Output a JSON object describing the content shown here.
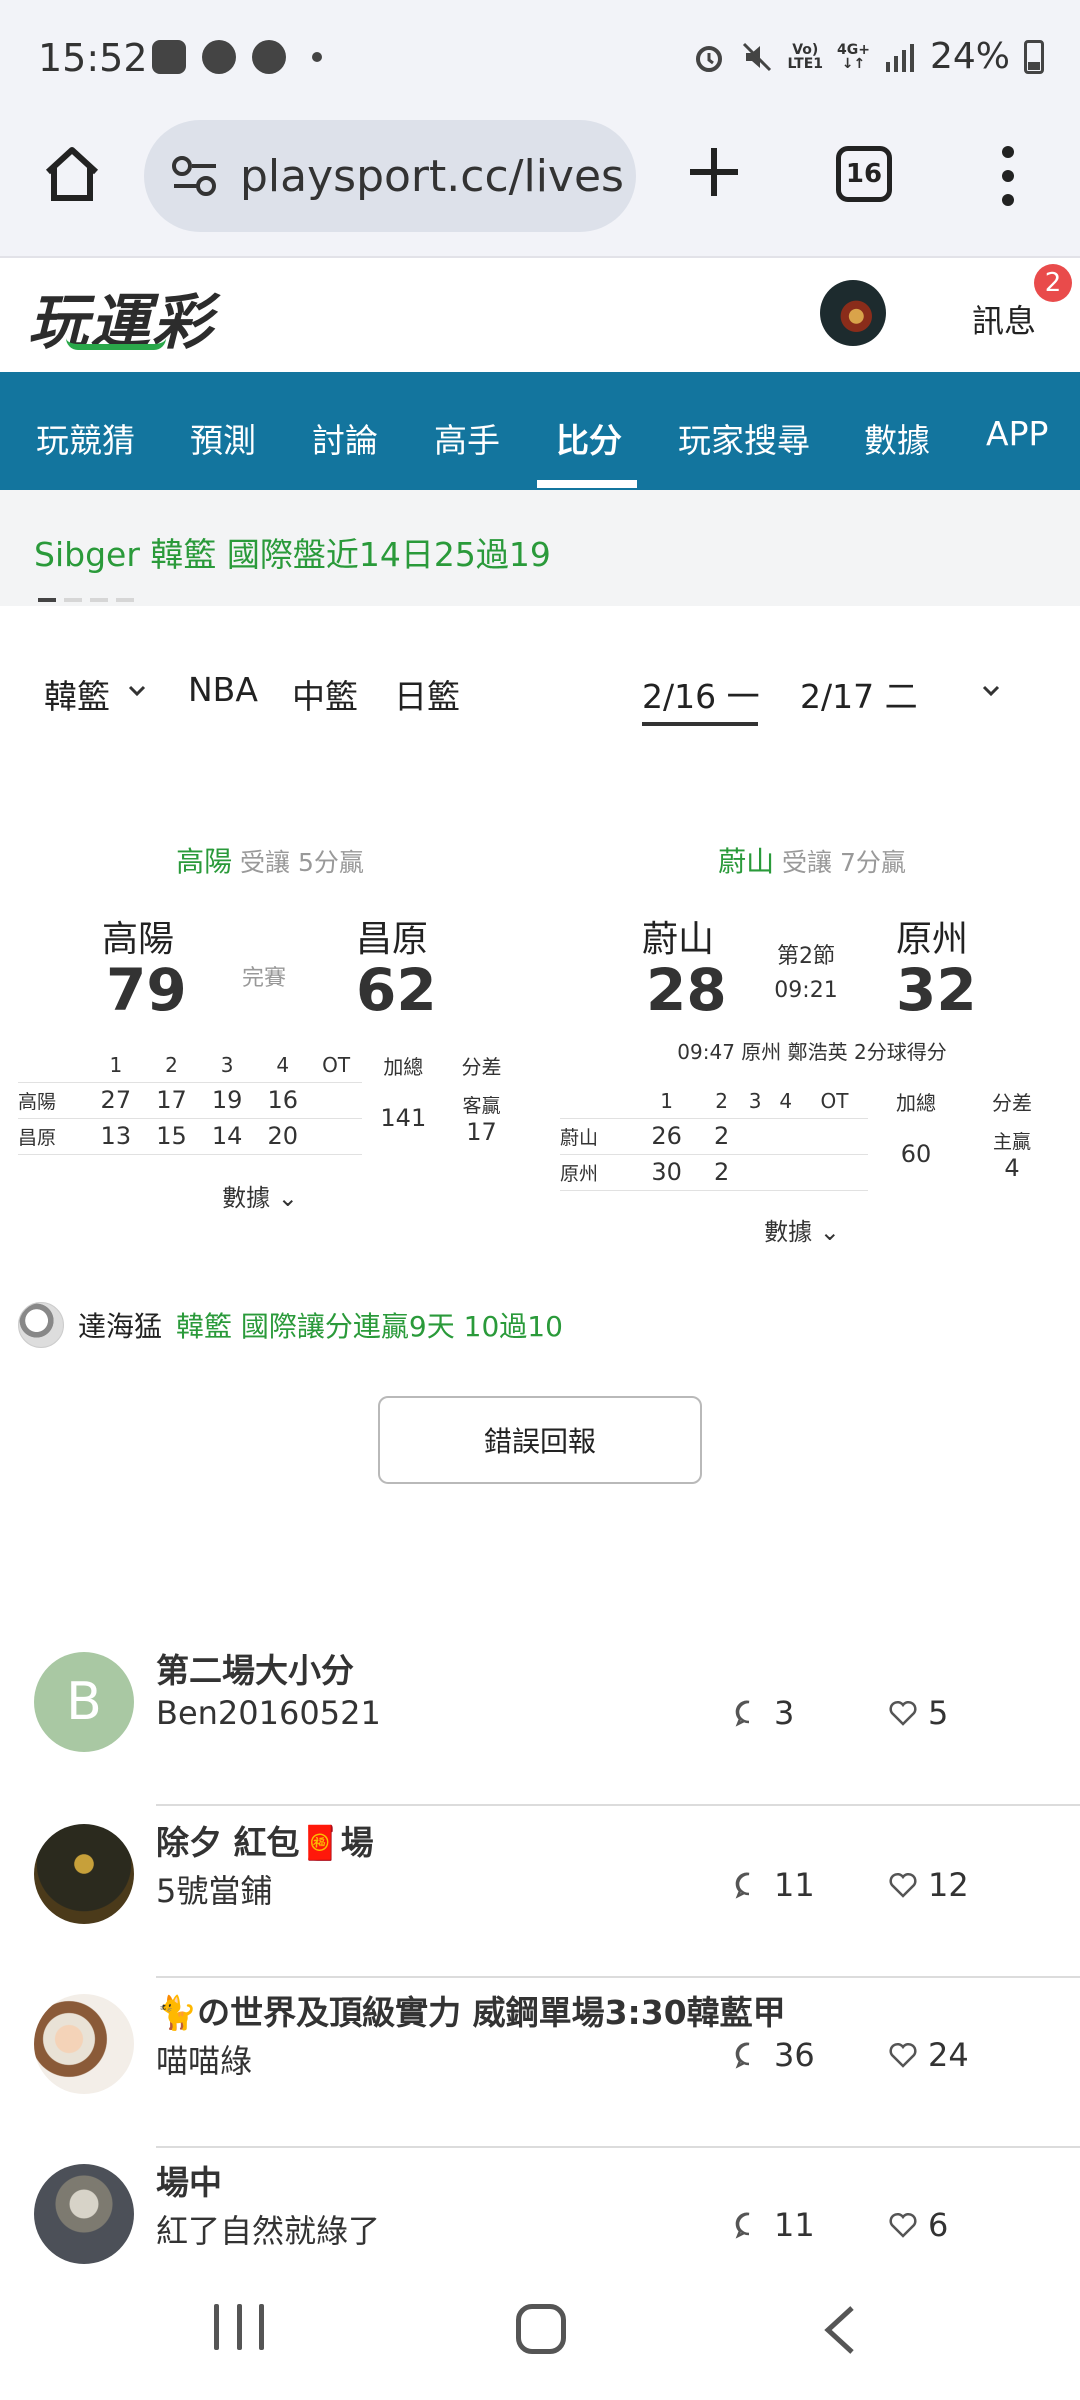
{
  "status_bar": {
    "time": "15:52",
    "network_top": "Vo)",
    "network_bottom": "LTE1",
    "data_top": "4G+",
    "data_bottom": "↓↑",
    "battery": "24%"
  },
  "browser": {
    "url": "playsport.cc/lives",
    "tab_count": "16"
  },
  "site": {
    "logo": "玩運彩",
    "messages_label": "訊息",
    "messages_badge": "2"
  },
  "nav": {
    "items": [
      "玩競猜",
      "預測",
      "討論",
      "高手",
      "比分",
      "玩家搜尋",
      "數據",
      "APP"
    ],
    "active_index": 4
  },
  "ticker": {
    "text": "Sibger  韓籃 國際盤近14日25過19"
  },
  "filters": {
    "league_selected": "韓籃",
    "leagues": [
      "NBA",
      "中籃",
      "日籃"
    ],
    "dates": [
      "2/16 一",
      "2/17 二"
    ],
    "active_date": "2/16 一"
  },
  "games": [
    {
      "header_team": "高陽",
      "header_note": "受讓 5分贏",
      "away_team": "高陽",
      "home_team": "昌原",
      "away_score": "79",
      "home_score": "62",
      "status": "完賽",
      "quarters_header": [
        "1",
        "2",
        "3",
        "4",
        "OT",
        "加總",
        "分差"
      ],
      "rows": [
        {
          "team": "高陽",
          "q": [
            "27",
            "17",
            "19",
            "16",
            ""
          ]
        },
        {
          "team": "昌原",
          "q": [
            "13",
            "15",
            "14",
            "20",
            ""
          ]
        }
      ],
      "total": "141",
      "diff_label": "客贏",
      "diff_value": "17",
      "stats_link": "數據"
    },
    {
      "header_team": "蔚山",
      "header_note": "受讓 7分贏",
      "away_team": "蔚山",
      "home_team": "原州",
      "away_score": "28",
      "home_score": "32",
      "period": "第2節",
      "clock": "09:21",
      "event": "09:47 原州 鄭浩英 2分球得分",
      "quarters_header": [
        "1",
        "2",
        "3",
        "4",
        "OT",
        "加總",
        "分差"
      ],
      "rows": [
        {
          "team": "蔚山",
          "q": [
            "26",
            "2",
            "",
            "",
            ""
          ]
        },
        {
          "team": "原州",
          "q": [
            "30",
            "2",
            "",
            "",
            ""
          ]
        }
      ],
      "total": "60",
      "diff_label": "主贏",
      "diff_value": "4",
      "stats_link": "數據"
    }
  ],
  "tip": {
    "user": "達海猛",
    "text": "韓籃 國際讓分連贏9天 10過10"
  },
  "report_button": "錯誤回報",
  "posts": [
    {
      "title": "第二場大小分",
      "author": "Ben20160521",
      "comments": "3",
      "likes": "5",
      "avatar_letter": "B"
    },
    {
      "title": "除夕 紅包🧧場",
      "author": "5號當鋪",
      "comments": "11",
      "likes": "12",
      "avatar_letter": ""
    },
    {
      "title": "🐈の世界及頂級實力 威鋼單場3:30韓藍甲",
      "author": "喵喵綠",
      "comments": "36",
      "likes": "24",
      "avatar_letter": ""
    },
    {
      "title": "場中",
      "author": "紅了自然就綠了",
      "comments": "11",
      "likes": "6",
      "avatar_letter": ""
    }
  ],
  "colors": {
    "nav_bg": "#13759e",
    "accent_green": "#2a9a3a",
    "badge_red": "#e94b4b"
  }
}
